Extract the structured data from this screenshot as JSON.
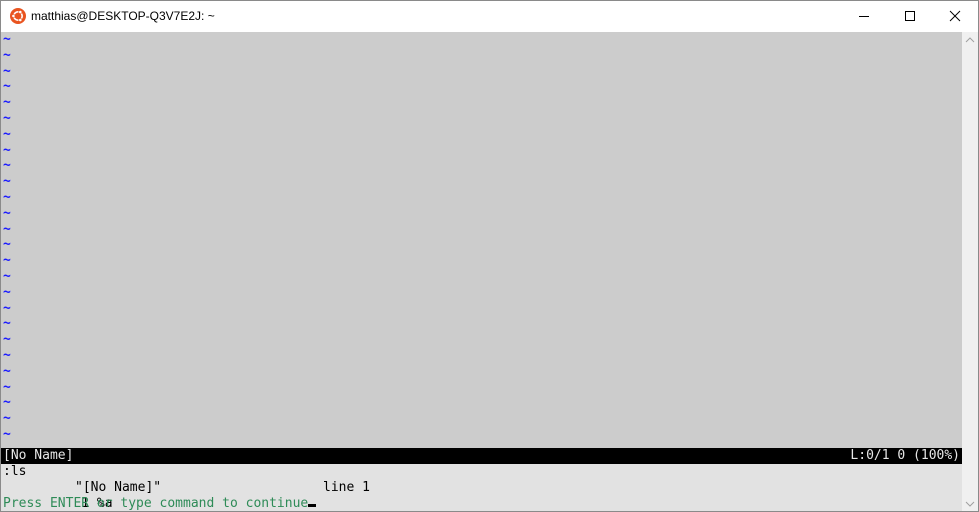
{
  "window": {
    "title": "matthias@DESKTOP-Q3V7E2J: ~",
    "app_icon": "ubuntu-icon",
    "accent_color": "#e95420"
  },
  "editor": {
    "empty_line_marker": "~",
    "empty_line_count": 26
  },
  "statusline": {
    "filename": "[No Name]",
    "position": "L:0/1 0 (100%)"
  },
  "command_output": {
    "command": ":ls",
    "buffer": {
      "number_flags": "  1 %a",
      "name": "\"[No Name]\"",
      "line": "line 1"
    },
    "prompt": "Press ENTER or type command to continue"
  }
}
